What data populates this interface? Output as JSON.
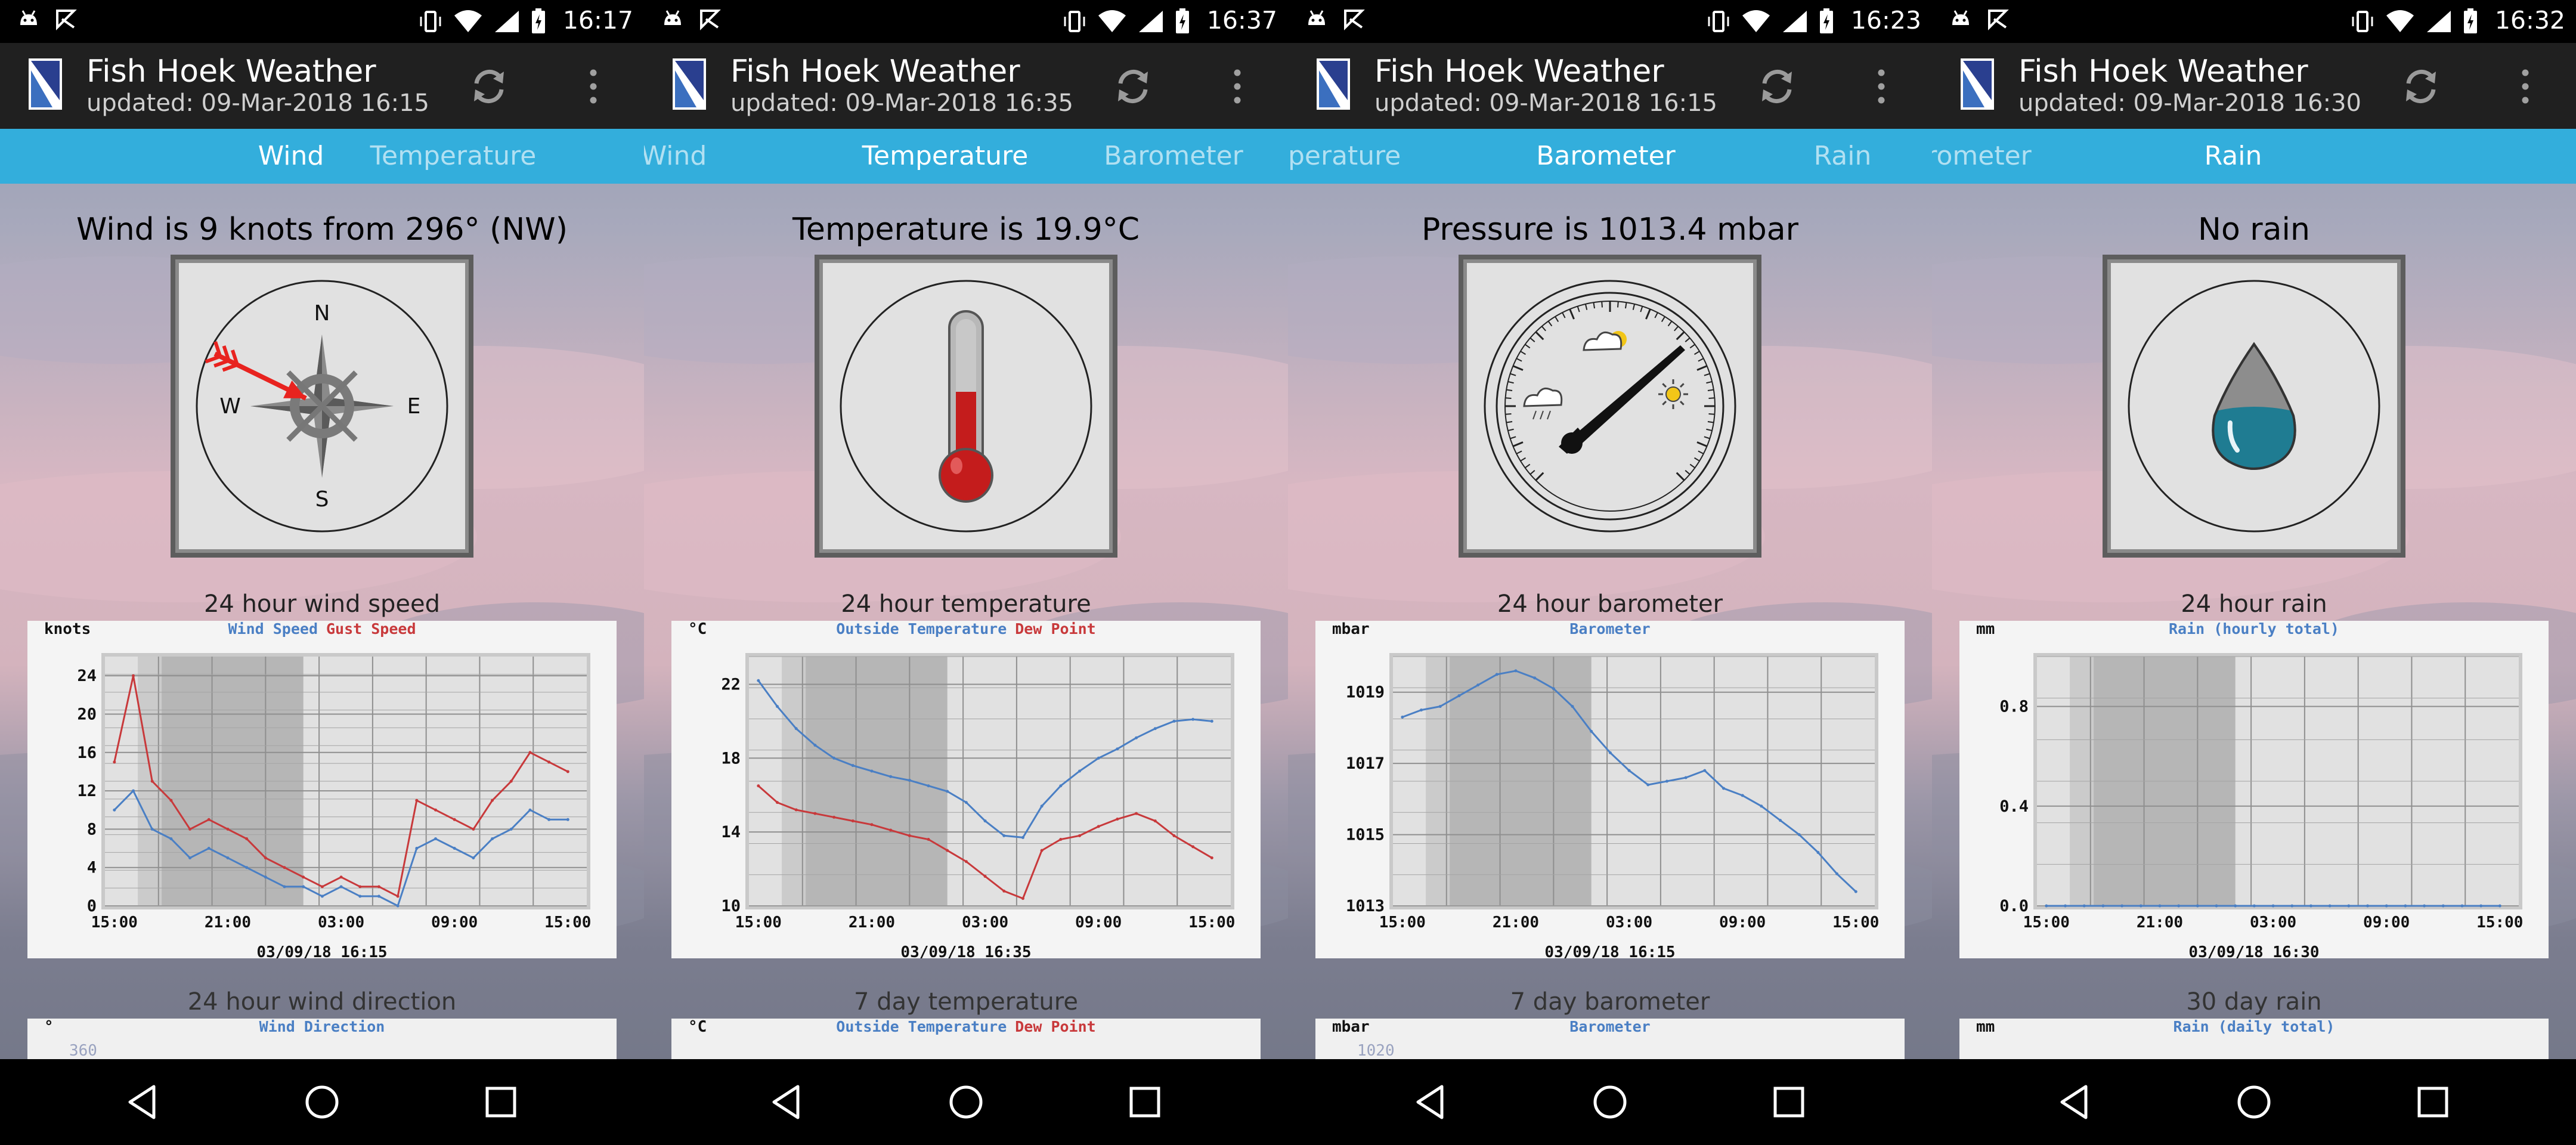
{
  "screens": [
    {
      "status": {
        "time": "16:17"
      },
      "app": {
        "title": "Fish Hoek Weather",
        "updated": "updated: 09-Mar-2018 16:15"
      },
      "tabs": [
        {
          "label": "Wind",
          "x": 488,
          "active": true
        },
        {
          "label": "Temperature",
          "x": 760,
          "active": false
        }
      ],
      "headline": "Wind is 9 knots from 296° (NW)",
      "gauge": {
        "type": "compass",
        "labels": [
          "N",
          "E",
          "S",
          "W"
        ],
        "direction_deg": 296
      },
      "graph_title": "24 hour wind speed",
      "graph": {
        "unit": "knots",
        "legend": [
          {
            "name": "Wind Speed",
            "color": "#4a7fc4"
          },
          {
            "name": "Gust Speed",
            "color": "#c8393b"
          }
        ],
        "ylabels": [
          "24",
          "20",
          "16",
          "12",
          "8",
          "4",
          "0"
        ],
        "xlabels": [
          "15:00",
          "21:00",
          "03:00",
          "09:00",
          "15:00"
        ],
        "timestamp": "03/09/18 16:15"
      },
      "graph2_title": "24 hour wind direction",
      "graph2": {
        "unit": "°",
        "legend": [
          {
            "name": "Wind Direction",
            "color": "#4a7fc4"
          }
        ],
        "partial_tick": "360"
      }
    },
    {
      "status": {
        "time": "16:37"
      },
      "app": {
        "title": "Fish Hoek Weather",
        "updated": "updated: 09-Mar-2018 16:35"
      },
      "tabs": [
        {
          "label": "Wind",
          "x": 50,
          "active": false
        },
        {
          "label": "Temperature",
          "x": 505,
          "active": true
        },
        {
          "label": "Barometer",
          "x": 888,
          "active": false
        }
      ],
      "headline": "Temperature is 19.9°C",
      "gauge": {
        "type": "thermometer"
      },
      "graph_title": "24 hour temperature",
      "graph": {
        "unit": "°C",
        "legend": [
          {
            "name": "Outside Temperature",
            "color": "#4a7fc4"
          },
          {
            "name": "Dew Point",
            "color": "#c8393b"
          }
        ],
        "ylabels": [
          "22",
          "18",
          "14",
          "10"
        ],
        "xlabels": [
          "15:00",
          "21:00",
          "03:00",
          "09:00",
          "15:00"
        ],
        "timestamp": "03/09/18 16:35"
      },
      "graph2_title": "7 day temperature",
      "graph2": {
        "unit": "°C",
        "legend": [
          {
            "name": "Outside Temperature",
            "color": "#4a7fc4"
          },
          {
            "name": "Dew Point",
            "color": "#c8393b"
          }
        ],
        "partial_tick": ""
      }
    },
    {
      "status": {
        "time": "16:23"
      },
      "app": {
        "title": "Fish Hoek Weather",
        "updated": "updated: 09-Mar-2018 16:15"
      },
      "tabs": [
        {
          "label": "Temperature",
          "x": 50,
          "active": false
        },
        {
          "label": "Barometer",
          "x": 533,
          "active": true
        },
        {
          "label": "Rain",
          "x": 930,
          "active": false
        }
      ],
      "headline": "Pressure is 1013.4 mbar",
      "gauge": {
        "type": "barometer"
      },
      "graph_title": "24 hour barometer",
      "graph": {
        "unit": "mbar",
        "legend": [
          {
            "name": "Barometer",
            "color": "#4a7fc4"
          }
        ],
        "ylabels": [
          "1019",
          "1017",
          "1015",
          "1013"
        ],
        "xlabels": [
          "15:00",
          "21:00",
          "03:00",
          "09:00",
          "15:00"
        ],
        "timestamp": "03/09/18 16:15"
      },
      "graph2_title": "7 day barometer",
      "graph2": {
        "unit": "mbar",
        "legend": [
          {
            "name": "Barometer",
            "color": "#4a7fc4"
          }
        ],
        "partial_tick": "1020"
      }
    },
    {
      "status": {
        "time": "16:32"
      },
      "app": {
        "title": "Fish Hoek Weather",
        "updated": "updated: 09-Mar-2018 16:30"
      },
      "tabs": [
        {
          "label": "Barometer",
          "x": 50,
          "active": false
        },
        {
          "label": "Rain",
          "x": 505,
          "active": true
        }
      ],
      "headline": "No rain",
      "gauge": {
        "type": "raindrop"
      },
      "graph_title": "24 hour rain",
      "graph": {
        "unit": "mm",
        "legend": [
          {
            "name": "Rain (hourly total)",
            "color": "#4a7fc4"
          }
        ],
        "ylabels": [
          "0.8",
          "0.4",
          "0.0"
        ],
        "xlabels": [
          "15:00",
          "21:00",
          "03:00",
          "09:00",
          "15:00"
        ],
        "timestamp": "03/09/18 16:30"
      },
      "graph2_title": "30 day rain",
      "graph2": {
        "unit": "mm",
        "legend": [
          {
            "name": "Rain (daily total)",
            "color": "#4a7fc4"
          }
        ],
        "partial_tick": ""
      }
    }
  ],
  "chart_data": [
    {
      "type": "line",
      "title": "24 hour wind speed",
      "ylabel": "knots",
      "ylim": [
        0,
        26
      ],
      "x_labels": [
        "15:00",
        "21:00",
        "03:00",
        "09:00",
        "15:00"
      ],
      "series": [
        {
          "name": "Wind Speed",
          "color": "#4a7fc4",
          "x": [
            0,
            1,
            2,
            3,
            4,
            5,
            6,
            7,
            8,
            9,
            10,
            11,
            12,
            13,
            14,
            15,
            16,
            17,
            18,
            19,
            20,
            21,
            22,
            23,
            24
          ],
          "values": [
            10,
            12,
            8,
            7,
            5,
            6,
            5,
            4,
            3,
            2,
            2,
            1,
            2,
            1,
            1,
            0,
            6,
            7,
            6,
            5,
            7,
            8,
            10,
            9,
            9
          ]
        },
        {
          "name": "Gust Speed",
          "color": "#c8393b",
          "x": [
            0,
            1,
            2,
            3,
            4,
            5,
            6,
            7,
            8,
            9,
            10,
            11,
            12,
            13,
            14,
            15,
            16,
            17,
            18,
            19,
            20,
            21,
            22,
            23,
            24
          ],
          "values": [
            15,
            24,
            13,
            11,
            8,
            9,
            8,
            7,
            5,
            4,
            3,
            2,
            3,
            2,
            2,
            1,
            11,
            10,
            9,
            8,
            11,
            13,
            16,
            15,
            14
          ]
        }
      ]
    },
    {
      "type": "line",
      "title": "24 hour temperature",
      "ylabel": "°C",
      "ylim": [
        10,
        23.5
      ],
      "x_labels": [
        "15:00",
        "21:00",
        "03:00",
        "09:00",
        "15:00"
      ],
      "series": [
        {
          "name": "Outside Temperature",
          "color": "#4a7fc4",
          "x": [
            0,
            1,
            2,
            3,
            4,
            5,
            6,
            7,
            8,
            9,
            10,
            11,
            12,
            13,
            14,
            15,
            16,
            17,
            18,
            19,
            20,
            21,
            22,
            23,
            24
          ],
          "values": [
            22.2,
            20.8,
            19.6,
            18.7,
            18.0,
            17.6,
            17.3,
            17.0,
            16.8,
            16.5,
            16.2,
            15.6,
            14.6,
            13.8,
            13.7,
            15.4,
            16.5,
            17.3,
            18.0,
            18.5,
            19.1,
            19.6,
            20.0,
            20.1,
            20.0
          ]
        },
        {
          "name": "Dew Point",
          "color": "#c8393b",
          "x": [
            0,
            1,
            2,
            3,
            4,
            5,
            6,
            7,
            8,
            9,
            10,
            11,
            12,
            13,
            14,
            15,
            16,
            17,
            18,
            19,
            20,
            21,
            22,
            23,
            24
          ],
          "values": [
            16.5,
            15.6,
            15.2,
            15.0,
            14.8,
            14.6,
            14.4,
            14.1,
            13.8,
            13.6,
            13.0,
            12.4,
            11.6,
            10.8,
            10.4,
            13.0,
            13.6,
            13.8,
            14.3,
            14.7,
            15.0,
            14.6,
            13.8,
            13.2,
            12.6
          ]
        }
      ]
    },
    {
      "type": "line",
      "title": "24 hour barometer",
      "ylabel": "mbar",
      "ylim": [
        1013,
        1020
      ],
      "x_labels": [
        "15:00",
        "21:00",
        "03:00",
        "09:00",
        "15:00"
      ],
      "series": [
        {
          "name": "Barometer",
          "color": "#4a7fc4",
          "x": [
            0,
            1,
            2,
            3,
            4,
            5,
            6,
            7,
            8,
            9,
            10,
            11,
            12,
            13,
            14,
            15,
            16,
            17,
            18,
            19,
            20,
            21,
            22,
            23,
            24
          ],
          "values": [
            1018.3,
            1018.5,
            1018.6,
            1018.9,
            1019.2,
            1019.5,
            1019.6,
            1019.4,
            1019.1,
            1018.6,
            1017.9,
            1017.3,
            1016.8,
            1016.4,
            1016.5,
            1016.6,
            1016.8,
            1016.3,
            1016.1,
            1015.8,
            1015.4,
            1015.0,
            1014.5,
            1013.9,
            1013.4
          ]
        }
      ]
    },
    {
      "type": "bar",
      "title": "24 hour rain",
      "ylabel": "mm",
      "ylim": [
        0,
        1
      ],
      "x_labels": [
        "15:00",
        "21:00",
        "03:00",
        "09:00",
        "15:00"
      ],
      "series": [
        {
          "name": "Rain (hourly total)",
          "color": "#4a7fc4",
          "x": [
            0,
            1,
            2,
            3,
            4,
            5,
            6,
            7,
            8,
            9,
            10,
            11,
            12,
            13,
            14,
            15,
            16,
            17,
            18,
            19,
            20,
            21,
            22,
            23,
            24
          ],
          "values": [
            0,
            0,
            0,
            0,
            0,
            0,
            0,
            0,
            0,
            0,
            0,
            0,
            0,
            0,
            0,
            0,
            0,
            0,
            0,
            0,
            0,
            0,
            0,
            0,
            0
          ]
        }
      ]
    }
  ]
}
